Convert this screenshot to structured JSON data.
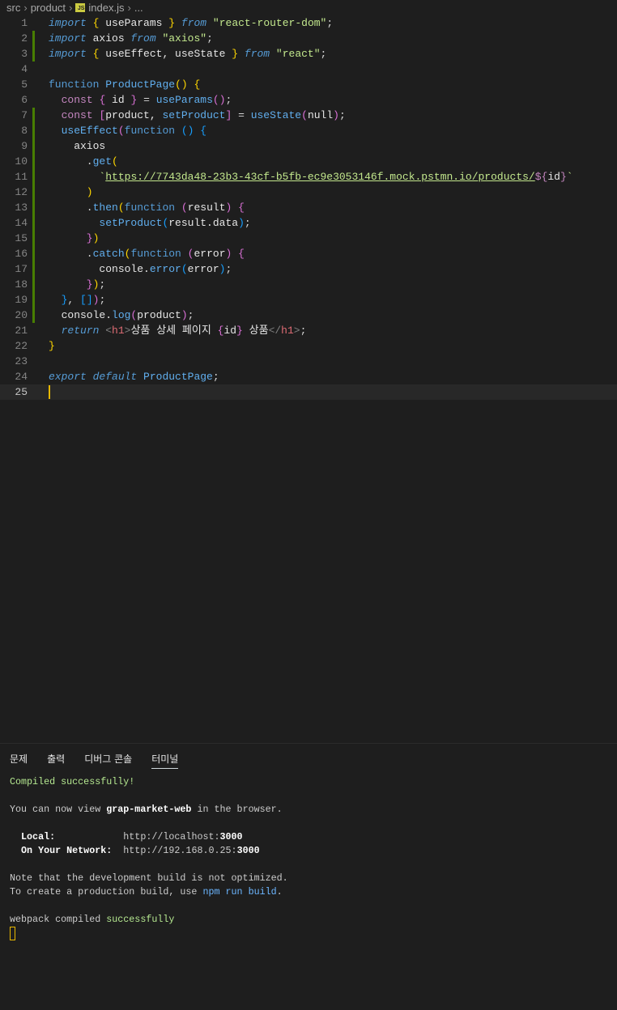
{
  "breadcrumb": {
    "items": [
      "src",
      "product",
      "index.js",
      "..."
    ],
    "file_icon": "JS"
  },
  "editor": {
    "current_line": 25,
    "modified_lines": [
      2,
      3,
      7,
      8,
      9,
      10,
      11,
      12,
      13,
      14,
      15,
      16,
      17,
      18,
      19,
      20
    ],
    "lines": [
      [
        [
          "k",
          "import"
        ],
        [
          "p",
          " "
        ],
        [
          "b1",
          "{"
        ],
        [
          "v",
          " useParams "
        ],
        [
          "b1",
          "}"
        ],
        [
          "p",
          " "
        ],
        [
          "k",
          "from"
        ],
        [
          "p",
          " "
        ],
        [
          "s",
          "\"react-router-dom\""
        ],
        [
          "p",
          ";"
        ]
      ],
      [
        [
          "k",
          "import"
        ],
        [
          "v",
          " axios "
        ],
        [
          "k",
          "from"
        ],
        [
          "p",
          " "
        ],
        [
          "s",
          "\"axios\""
        ],
        [
          "p",
          ";"
        ]
      ],
      [
        [
          "k",
          "import"
        ],
        [
          "p",
          " "
        ],
        [
          "b1",
          "{"
        ],
        [
          "v",
          " useEffect, useState "
        ],
        [
          "b1",
          "}"
        ],
        [
          "p",
          " "
        ],
        [
          "k",
          "from"
        ],
        [
          "p",
          " "
        ],
        [
          "s",
          "\"react\""
        ],
        [
          "p",
          ";"
        ]
      ],
      [],
      [
        [
          "fn",
          "function"
        ],
        [
          "p",
          " "
        ],
        [
          "f",
          "ProductPage"
        ],
        [
          "b1",
          "()"
        ],
        [
          "p",
          " "
        ],
        [
          "b1",
          "{"
        ]
      ],
      [
        [
          "p",
          "  "
        ],
        [
          "c",
          "const"
        ],
        [
          "p",
          " "
        ],
        [
          "b2",
          "{"
        ],
        [
          "v",
          " id "
        ],
        [
          "b2",
          "}"
        ],
        [
          "p",
          " = "
        ],
        [
          "f",
          "useParams"
        ],
        [
          "b2",
          "()"
        ],
        [
          "p",
          ";"
        ]
      ],
      [
        [
          "p",
          "  "
        ],
        [
          "c",
          "const"
        ],
        [
          "p",
          " "
        ],
        [
          "b2",
          "["
        ],
        [
          "v",
          "product, "
        ],
        [
          "f",
          "setProduct"
        ],
        [
          "b2",
          "]"
        ],
        [
          "p",
          " = "
        ],
        [
          "f",
          "useState"
        ],
        [
          "b2",
          "("
        ],
        [
          "v",
          "null"
        ],
        [
          "b2",
          ")"
        ],
        [
          "p",
          ";"
        ]
      ],
      [
        [
          "p",
          "  "
        ],
        [
          "f",
          "useEffect"
        ],
        [
          "b2",
          "("
        ],
        [
          "fn",
          "function"
        ],
        [
          "p",
          " "
        ],
        [
          "b3",
          "()"
        ],
        [
          "p",
          " "
        ],
        [
          "b3",
          "{"
        ]
      ],
      [
        [
          "v",
          "    axios"
        ]
      ],
      [
        [
          "p",
          "      ."
        ],
        [
          "f",
          "get"
        ],
        [
          "b1",
          "("
        ]
      ],
      [
        [
          "p",
          "        "
        ],
        [
          "s",
          "`"
        ],
        [
          "u",
          "https://7743da48-23b3-43cf-b5fb-ec9e3053146f.mock.pstmn.io/products/"
        ],
        [
          "c",
          "${"
        ],
        [
          "v",
          "id"
        ],
        [
          "c",
          "}"
        ],
        [
          "s",
          "`"
        ]
      ],
      [
        [
          "b1",
          "      )"
        ]
      ],
      [
        [
          "p",
          "      ."
        ],
        [
          "f",
          "then"
        ],
        [
          "b1",
          "("
        ],
        [
          "fn",
          "function"
        ],
        [
          "p",
          " "
        ],
        [
          "b2",
          "("
        ],
        [
          "v",
          "result"
        ],
        [
          "b2",
          ")"
        ],
        [
          "p",
          " "
        ],
        [
          "b2",
          "{"
        ]
      ],
      [
        [
          "p",
          "        "
        ],
        [
          "f",
          "setProduct"
        ],
        [
          "b3",
          "("
        ],
        [
          "v",
          "result.data"
        ],
        [
          "b3",
          ")"
        ],
        [
          "p",
          ";"
        ]
      ],
      [
        [
          "b2",
          "      }"
        ],
        [
          "b1",
          ")"
        ]
      ],
      [
        [
          "p",
          "      ."
        ],
        [
          "f",
          "catch"
        ],
        [
          "b1",
          "("
        ],
        [
          "fn",
          "function"
        ],
        [
          "p",
          " "
        ],
        [
          "b2",
          "("
        ],
        [
          "v",
          "error"
        ],
        [
          "b2",
          ")"
        ],
        [
          "p",
          " "
        ],
        [
          "b2",
          "{"
        ]
      ],
      [
        [
          "v",
          "        console."
        ],
        [
          "f",
          "error"
        ],
        [
          "b3",
          "("
        ],
        [
          "v",
          "error"
        ],
        [
          "b3",
          ")"
        ],
        [
          "p",
          ";"
        ]
      ],
      [
        [
          "b2",
          "      }"
        ],
        [
          "b1",
          ")"
        ],
        [
          "p",
          ";"
        ]
      ],
      [
        [
          "b3",
          "  }"
        ],
        [
          "p",
          ", "
        ],
        [
          "b3",
          "[]"
        ],
        [
          "b2",
          ")"
        ],
        [
          "p",
          ";"
        ]
      ],
      [
        [
          "v",
          "  console."
        ],
        [
          "f",
          "log"
        ],
        [
          "b2",
          "("
        ],
        [
          "v",
          "product"
        ],
        [
          "b2",
          ")"
        ],
        [
          "p",
          ";"
        ]
      ],
      [
        [
          "p",
          "  "
        ],
        [
          "k",
          "return"
        ],
        [
          "p",
          " "
        ],
        [
          "g",
          "<"
        ],
        [
          "t",
          "h1"
        ],
        [
          "g",
          ">"
        ],
        [
          "v",
          "상품 상세 페이지 "
        ],
        [
          "b2",
          "{"
        ],
        [
          "v",
          "id"
        ],
        [
          "b2",
          "}"
        ],
        [
          "v",
          " 상품"
        ],
        [
          "g",
          "</"
        ],
        [
          "t",
          "h1"
        ],
        [
          "g",
          ">"
        ],
        [
          "p",
          ";"
        ]
      ],
      [
        [
          "b1",
          "}"
        ]
      ],
      [],
      [
        [
          "k",
          "export"
        ],
        [
          "p",
          " "
        ],
        [
          "k",
          "default"
        ],
        [
          "p",
          " "
        ],
        [
          "f",
          "ProductPage"
        ],
        [
          "p",
          ";"
        ]
      ],
      []
    ]
  },
  "panel": {
    "tabs": [
      "문제",
      "출력",
      "디버그 콘솔",
      "터미널"
    ],
    "active_tab": 3,
    "terminal": [
      [
        [
          "tg",
          "Compiled successfully!"
        ]
      ],
      [],
      [
        [
          "tw",
          "You can now view "
        ],
        [
          "tb",
          "grap-market-web"
        ],
        [
          "tw",
          " in the browser."
        ]
      ],
      [],
      [
        [
          "tb",
          "  Local:            "
        ],
        [
          "tw",
          "http://localhost:"
        ],
        [
          "tb",
          "3000"
        ]
      ],
      [
        [
          "tb",
          "  On Your Network:  "
        ],
        [
          "tw",
          "http://192.168.0.25:"
        ],
        [
          "tb",
          "3000"
        ]
      ],
      [],
      [
        [
          "tw",
          "Note that the development build is not optimized."
        ]
      ],
      [
        [
          "tw",
          "To create a production build, use "
        ],
        [
          "tblue",
          "npm run build"
        ],
        [
          "tw",
          "."
        ]
      ],
      [],
      [
        [
          "tw",
          "webpack compiled "
        ],
        [
          "tg",
          "successfully"
        ]
      ]
    ]
  }
}
